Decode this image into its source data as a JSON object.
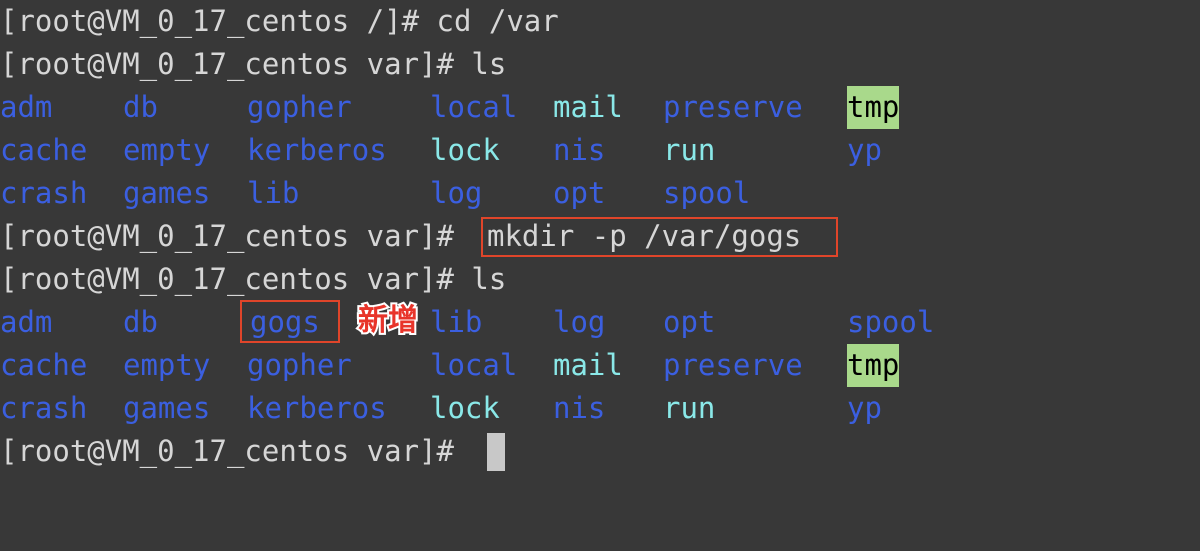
{
  "terminal": {
    "background_color": "#383838",
    "prompt_color": "#d6d6d6",
    "dir_color": "#3b5fe0",
    "symlink_color": "#8ae8e8",
    "sticky_bg_color": "#a9d98b",
    "sticky_fg_color": "#000000",
    "annotation_color": "#e8342a",
    "annotation_box_color": "#e0452a",
    "cursor_color": "#c8c8c8"
  },
  "lines": {
    "prompt_1": "[root@VM_0_17_centos /]# cd /var",
    "prompt_2": "[root@VM_0_17_centos var]# ls",
    "prompt_3_prefix": "[root@VM_0_17_centos var]# ",
    "prompt_3_command": "mkdir -p /var/gogs",
    "prompt_4": "[root@VM_0_17_centos var]# ls",
    "prompt_5": "[root@VM_0_17_centos var]# "
  },
  "ls_first": {
    "row1": [
      "adm",
      "db",
      "gopher",
      "local",
      "mail",
      "preserve",
      "tmp"
    ],
    "row2": [
      "cache",
      "empty",
      "kerberos",
      "lock",
      "nis",
      "run",
      "yp"
    ],
    "row3": [
      "crash",
      "games",
      "lib",
      "log",
      "opt",
      "spool"
    ],
    "types_row1": [
      "dir",
      "dir",
      "dir",
      "dir",
      "link",
      "dir",
      "sticky"
    ],
    "types_row2": [
      "dir",
      "dir",
      "dir",
      "link",
      "dir",
      "link",
      "dir"
    ],
    "types_row3": [
      "dir",
      "dir",
      "dir",
      "dir",
      "dir",
      "dir"
    ]
  },
  "ls_second": {
    "row1": [
      "adm",
      "db",
      "gogs",
      "lib",
      "log",
      "opt",
      "spool"
    ],
    "row2": [
      "cache",
      "empty",
      "gopher",
      "local",
      "mail",
      "preserve",
      "tmp"
    ],
    "row3": [
      "crash",
      "games",
      "kerberos",
      "lock",
      "nis",
      "run",
      "yp"
    ],
    "types_row1": [
      "dir",
      "dir",
      "dir",
      "dir",
      "dir",
      "dir",
      "dir"
    ],
    "types_row2": [
      "dir",
      "dir",
      "dir",
      "dir",
      "link",
      "dir",
      "sticky"
    ],
    "types_row3": [
      "dir",
      "dir",
      "dir",
      "link",
      "dir",
      "link",
      "dir"
    ]
  },
  "annotations": {
    "new_label": "新增"
  }
}
